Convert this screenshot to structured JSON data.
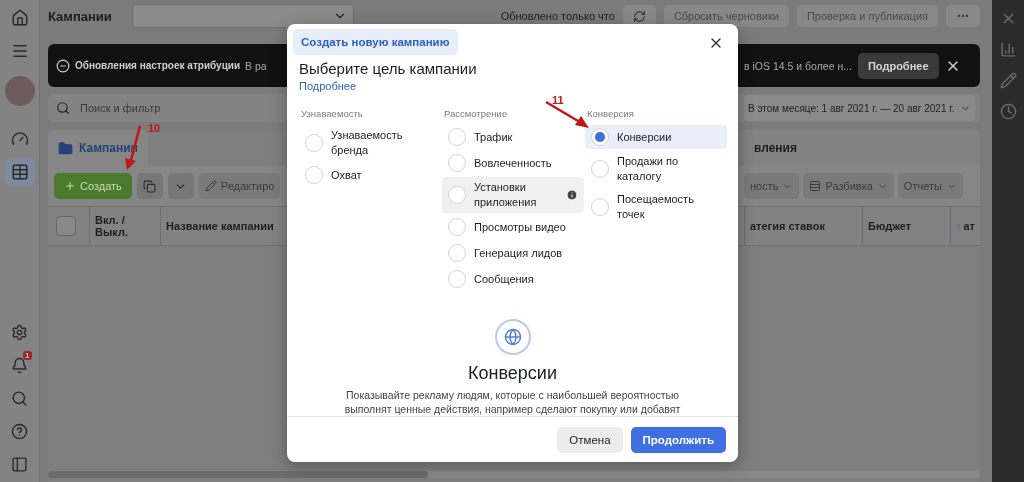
{
  "left_sidebar": {
    "items": [
      {
        "selected": false
      },
      {
        "selected": false
      },
      {
        "selected": false
      },
      {
        "selected": false
      },
      {
        "selected": true
      }
    ],
    "notification_badge": "1"
  },
  "top_bar": {
    "title": "Кампании",
    "status": "Обновлено только что",
    "buttons": [
      "Сбросить черновики",
      "Проверка и публикация"
    ]
  },
  "banner": {
    "title": "Обновления настроек атрибуции",
    "text_start": "В ра",
    "text_end": "в iOS 14.5 и более н...",
    "button": "Подробнее"
  },
  "search": {
    "placeholder": "Поиск и фильтр",
    "date_range": "В этом месяце: 1 авг 2021 г. — 20 авг 2021 г."
  },
  "tabs": [
    {
      "label": "Кампании",
      "selected": true
    },
    {
      "label": "вления",
      "selected": false
    }
  ],
  "toolbar": {
    "create": "Создать",
    "edit": "Редактиро",
    "right_buttons": [
      "ность",
      "Разбивка",
      "Отчеты"
    ]
  },
  "table": {
    "select_all_checked": false,
    "columns": [
      "Вкл. / Выкл.",
      "Название кампании",
      "атегия ставок",
      "Бюджет",
      "ат"
    ]
  },
  "annotations": [
    {
      "label": "10"
    },
    {
      "label": "11"
    }
  ],
  "modal": {
    "tab": "Создать новую кампанию",
    "title": "Выберите цель кампании",
    "link": "Подробнее",
    "groups": [
      {
        "heading": "Узнаваемость",
        "options": [
          {
            "label": "Узнаваемость бренда",
            "selected": false,
            "hovered": false,
            "info": false
          },
          {
            "label": "Охват",
            "selected": false,
            "hovered": false,
            "info": false
          }
        ]
      },
      {
        "heading": "Рассмотрение",
        "options": [
          {
            "label": "Трафик",
            "selected": false,
            "hovered": false,
            "info": false
          },
          {
            "label": "Вовлеченность",
            "selected": false,
            "hovered": false,
            "info": false
          },
          {
            "label": "Установки приложения",
            "selected": false,
            "hovered": true,
            "info": true
          },
          {
            "label": "Просмотры видео",
            "selected": false,
            "hovered": false,
            "info": false
          },
          {
            "label": "Генерация лидов",
            "selected": false,
            "hovered": false,
            "info": false
          },
          {
            "label": "Сообщения",
            "selected": false,
            "hovered": false,
            "info": false
          }
        ]
      },
      {
        "heading": "Конверсия",
        "options": [
          {
            "label": "Конверсии",
            "selected": true,
            "hovered": false,
            "info": false
          },
          {
            "label": "Продажи по каталогу",
            "selected": false,
            "hovered": false,
            "info": false
          },
          {
            "label": "Посещаемость точек",
            "selected": false,
            "hovered": false,
            "info": false
          }
        ]
      }
    ],
    "detail_title": "Конверсии",
    "detail_text": "Показывайте рекламу людям, которые с наибольшей вероятностью выполнят ценные действия, например сделают покупку или добавят",
    "cancel": "Отмена",
    "continue": "Продолжить"
  }
}
